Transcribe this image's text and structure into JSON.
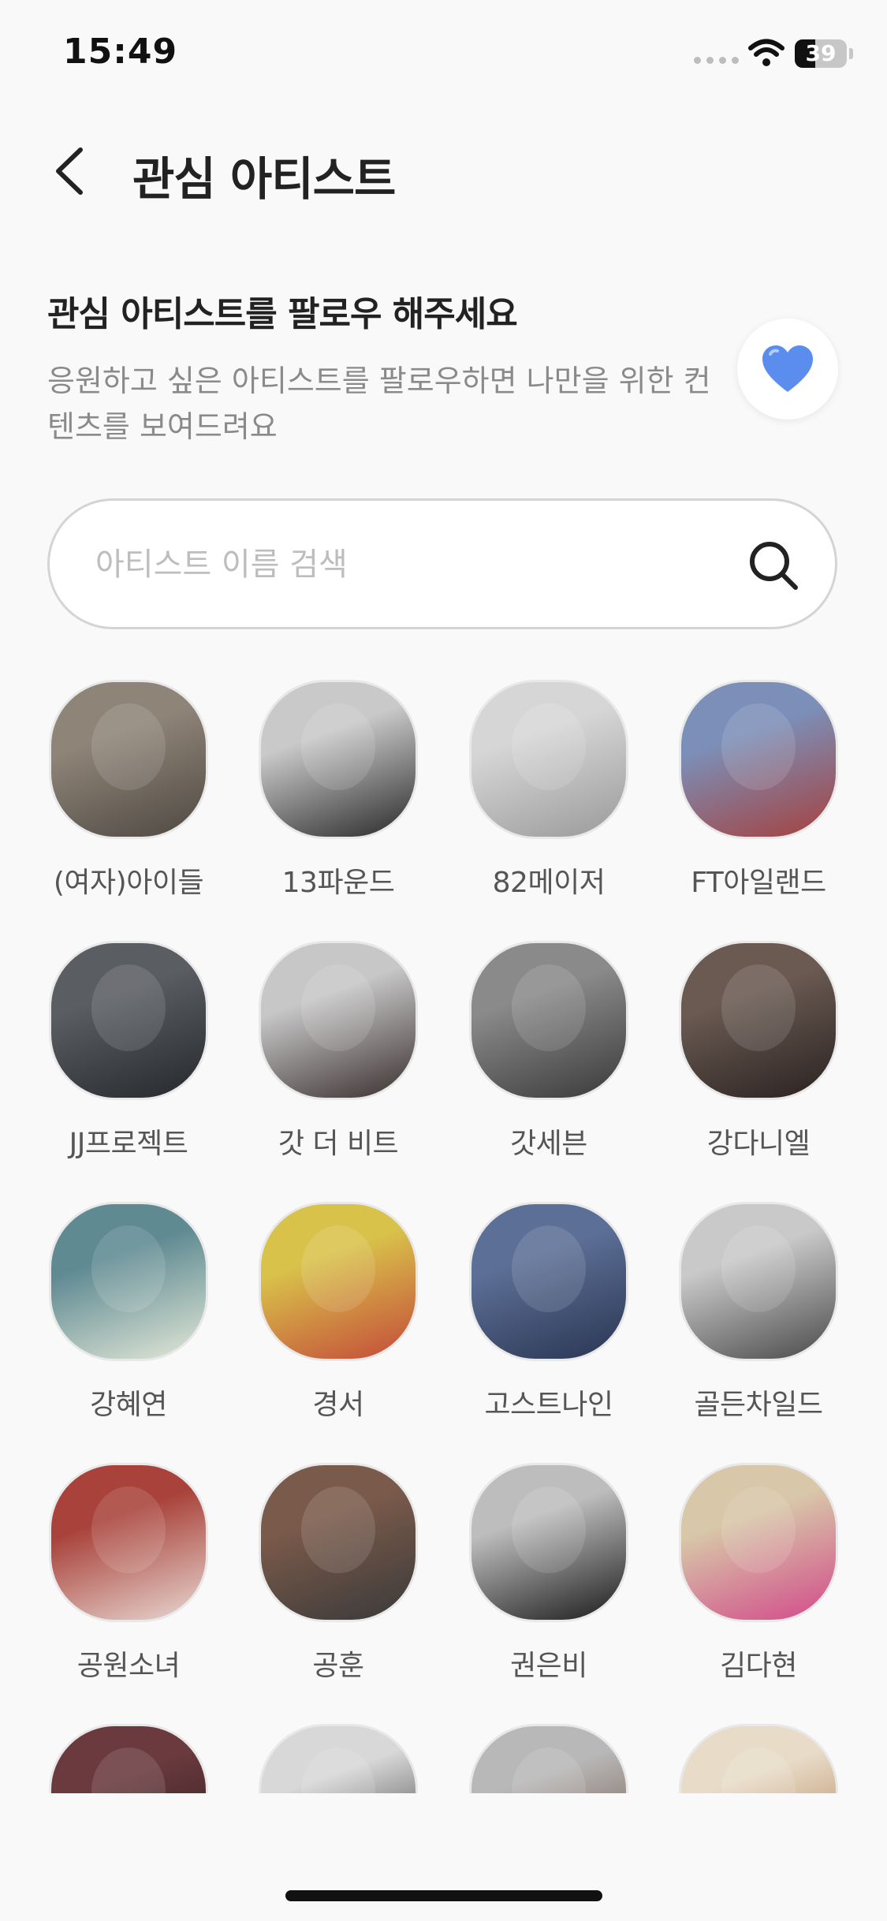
{
  "status_bar": {
    "time": "15:49",
    "battery_level": "39",
    "battery_fraction": 0.39
  },
  "header": {
    "back_label": "back",
    "title": "관심 아티스트"
  },
  "intro": {
    "heading": "관심 아티스트를 팔로우 해주세요",
    "description": "응원하고 싶은 아티스트를 팔로우하면 나만을 위한 컨텐츠를 보여드려요",
    "badge_icon": "blue-heart-icon",
    "badge_color": "#5b8def"
  },
  "search": {
    "placeholder": "아티스트 이름 검색",
    "value": "",
    "icon": "search-icon"
  },
  "artists": [
    {
      "name": "(여자)아이들",
      "photo_colors": [
        "#8f8478",
        "#4f4942"
      ]
    },
    {
      "name": "13파운드",
      "photo_colors": [
        "#c9c9c9",
        "#2a2a2a"
      ]
    },
    {
      "name": "82메이저",
      "photo_colors": [
        "#d6d6d6",
        "#9a9a9a"
      ]
    },
    {
      "name": "FT아일랜드",
      "photo_colors": [
        "#7c8fb8",
        "#a5413e"
      ]
    },
    {
      "name": "JJ프로젝트",
      "photo_colors": [
        "#5a5d62",
        "#25282c"
      ]
    },
    {
      "name": "갓 더 비트",
      "photo_colors": [
        "#c7c7c7",
        "#3a2f2f"
      ]
    },
    {
      "name": "갓세븐",
      "photo_colors": [
        "#8a8a8a",
        "#3a3a3a"
      ]
    },
    {
      "name": "강다니엘",
      "photo_colors": [
        "#6a5a52",
        "#2a2220"
      ]
    },
    {
      "name": "강혜연",
      "photo_colors": [
        "#5f8a92",
        "#e3e8d8"
      ]
    },
    {
      "name": "경서",
      "photo_colors": [
        "#d9c24a",
        "#c44a3a"
      ]
    },
    {
      "name": "고스트나인",
      "photo_colors": [
        "#5c6f96",
        "#2a3552"
      ]
    },
    {
      "name": "골든차일드",
      "photo_colors": [
        "#c9c9c9",
        "#4a4a4a"
      ]
    },
    {
      "name": "공원소녀",
      "photo_colors": [
        "#a8423a",
        "#e8d8d2"
      ]
    },
    {
      "name": "공훈",
      "photo_colors": [
        "#7a5a4a",
        "#3a3a3a"
      ]
    },
    {
      "name": "권은비",
      "photo_colors": [
        "#bdbdbd",
        "#1c1c1c"
      ]
    },
    {
      "name": "김다현",
      "photo_colors": [
        "#d8c7a8",
        "#d24a8a"
      ]
    },
    {
      "name": "",
      "photo_colors": [
        "#6a3a3e",
        "#2a1c1e"
      ]
    },
    {
      "name": "",
      "photo_colors": [
        "#d8d8d8",
        "#2a2a2a"
      ]
    },
    {
      "name": "",
      "photo_colors": [
        "#b8b8b8",
        "#6a4a3a"
      ]
    },
    {
      "name": "",
      "photo_colors": [
        "#e8dcc8",
        "#b0784a"
      ]
    }
  ]
}
